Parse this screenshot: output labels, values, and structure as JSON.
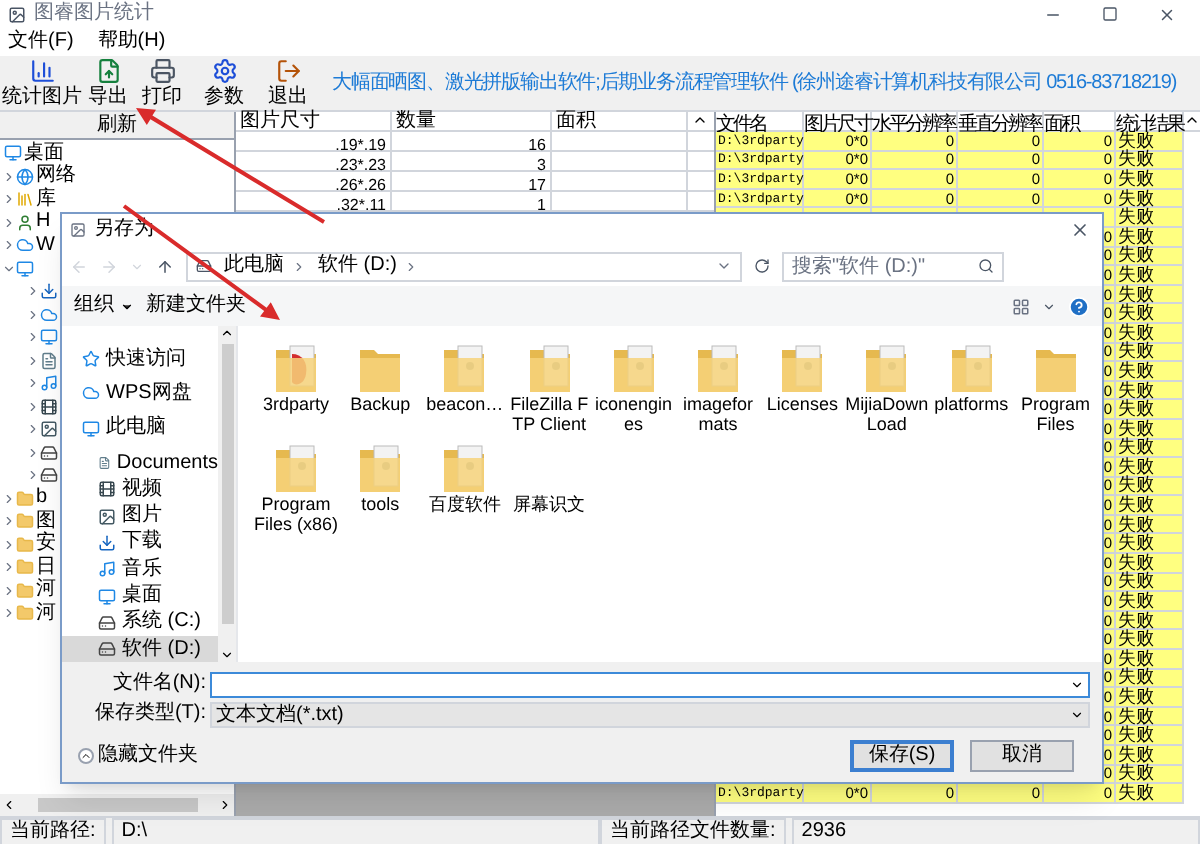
{
  "window": {
    "title": "图睿图片统计"
  },
  "menu": [
    "文件(F)",
    "帮助(H)"
  ],
  "toolbar": [
    {
      "label": "统计图片",
      "kind": "stats"
    },
    {
      "label": "导出",
      "kind": "export"
    },
    {
      "label": "打印",
      "kind": "print"
    },
    {
      "label": "参数",
      "kind": "settings"
    },
    {
      "label": "退出",
      "kind": "exit"
    }
  ],
  "banner": "大幅面晒图、激光拼版输出软件;后期业务流程管理软件 (徐州途睿计算机科技有限公司 0516-83718219)",
  "tree": {
    "header": "刷新",
    "items": [
      {
        "label": "桌面",
        "kind": "desktop",
        "expanded": true,
        "children": [
          {
            "label": "网络",
            "kind": "network",
            "expanded": false
          },
          {
            "label": "库",
            "kind": "library",
            "expanded": false
          },
          {
            "label": "H",
            "kind": "user",
            "expanded": false
          },
          {
            "label": "W",
            "kind": "cloud",
            "expanded": false
          },
          {
            "kind": "pc",
            "expanded": true,
            "children": [
              {
                "kind": "download",
                "expanded": false
              },
              {
                "kind": "cloud",
                "expanded": false
              },
              {
                "kind": "desktop",
                "expanded": false
              },
              {
                "kind": "doc",
                "expanded": false
              },
              {
                "kind": "music",
                "expanded": false
              },
              {
                "kind": "video",
                "expanded": false
              },
              {
                "kind": "image",
                "expanded": false
              },
              {
                "kind": "drive",
                "expanded": false
              },
              {
                "kind": "drive",
                "expanded": false
              }
            ]
          },
          {
            "label": "b",
            "kind": "folder",
            "expanded": false
          },
          {
            "label": "图",
            "kind": "folder",
            "expanded": false
          },
          {
            "label": "安",
            "kind": "folder",
            "expanded": false
          },
          {
            "label": "日",
            "kind": "folder",
            "expanded": false
          },
          {
            "label": "河",
            "kind": "folder",
            "expanded": false
          },
          {
            "label": "河",
            "kind": "folder",
            "expanded": false
          }
        ]
      }
    ]
  },
  "size_table": {
    "columns": [
      "图片尺寸",
      "数量",
      "面积"
    ],
    "rows": [
      {
        "size": ".19*.19",
        "count": "16"
      },
      {
        "size": ".23*.23",
        "count": "3"
      },
      {
        "size": ".26*.26",
        "count": "17"
      },
      {
        "size": ".32*.11",
        "count": "1"
      }
    ]
  },
  "file_table": {
    "columns": [
      "文件名",
      "图片尺寸",
      "水平分辨率",
      "垂直分辨率",
      "面积",
      "统计结果"
    ],
    "rows": [
      {
        "file": "D:\\3rdparty",
        "size": "0*0",
        "h_res": "0",
        "v_res": "0",
        "area": "0",
        "result": "失败"
      },
      {
        "file": "D:\\3rdparty",
        "size": "0*0",
        "h_res": "0",
        "v_res": "0",
        "area": "0",
        "result": "失败"
      },
      {
        "file": "D:\\3rdparty",
        "size": "0*0",
        "h_res": "0",
        "v_res": "0",
        "area": "0",
        "result": "失败"
      },
      {
        "file": "D:\\3rdparty",
        "size": "0*0",
        "h_res": "0",
        "v_res": "0",
        "area": "0",
        "result": "失败"
      },
      {
        "result": "失败"
      },
      {
        "area": "0",
        "result": "失败"
      },
      {
        "area": "0",
        "result": "失败"
      },
      {
        "area": "0",
        "result": "失败"
      },
      {
        "area": "0",
        "result": "失败"
      },
      {
        "area": "0",
        "result": "失败"
      },
      {
        "area": "0",
        "result": "失败"
      },
      {
        "area": "0",
        "result": "失败"
      },
      {
        "area": "0",
        "result": "失败"
      },
      {
        "area": "0",
        "result": "失败"
      },
      {
        "area": "0",
        "result": "失败"
      },
      {
        "area": "0",
        "result": "失败"
      },
      {
        "area": "0",
        "result": "失败"
      },
      {
        "area": "0",
        "result": "失败"
      },
      {
        "area": "0",
        "result": "失败"
      },
      {
        "area": "0",
        "result": "失败"
      },
      {
        "area": "0",
        "result": "失败"
      },
      {
        "area": "0",
        "result": "失败"
      },
      {
        "area": "0",
        "result": "失败"
      },
      {
        "area": "0",
        "result": "失败"
      },
      {
        "area": "0",
        "result": "失败"
      },
      {
        "area": "0",
        "result": "失败"
      },
      {
        "area": "0",
        "result": "失败"
      },
      {
        "area": "0",
        "result": "失败"
      },
      {
        "area": "0",
        "result": "失败"
      },
      {
        "area": "0",
        "result": "失败"
      },
      {
        "area": "0",
        "result": "失败"
      },
      {
        "area": "0",
        "result": "失败"
      },
      {
        "area": "0",
        "result": "失败"
      },
      {
        "area": "0",
        "result": "失败"
      },
      {
        "file": "D:\\3rdparty",
        "size": "0*0",
        "h_res": "0",
        "v_res": "0",
        "area": "0",
        "result": "失败"
      }
    ]
  },
  "status_bar": [
    {
      "label": "当前路径:",
      "value": "D:\\"
    },
    {
      "label": "当前路径文件数量:",
      "value": "2936"
    }
  ],
  "dialog": {
    "title": "另存为",
    "breadcrumb": [
      "此电脑",
      "软件 (D:)"
    ],
    "search_placeholder": "搜索\"软件 (D:)\"",
    "commands": [
      {
        "label": "组织",
        "dropdown": true
      },
      {
        "label": "新建文件夹",
        "dropdown": false
      }
    ],
    "nav": [
      {
        "label": "快速访问",
        "kind": "star",
        "selected": false,
        "group": true
      },
      {
        "label": "WPS网盘",
        "kind": "cloud",
        "selected": false,
        "group": true
      },
      {
        "label": "此电脑",
        "kind": "pc",
        "selected": false,
        "group": true
      },
      {
        "label": "Documents",
        "kind": "doc",
        "selected": false,
        "group": false
      },
      {
        "label": "视频",
        "kind": "video",
        "selected": false,
        "group": false
      },
      {
        "label": "图片",
        "kind": "image",
        "selected": false,
        "group": false
      },
      {
        "label": "下载",
        "kind": "download",
        "selected": false,
        "group": false
      },
      {
        "label": "音乐",
        "kind": "music",
        "selected": false,
        "group": false
      },
      {
        "label": "桌面",
        "kind": "desktop",
        "selected": false,
        "group": false
      },
      {
        "label": "系统 (C:)",
        "kind": "drive",
        "selected": false,
        "group": false
      },
      {
        "label": "软件 (D:)",
        "kind": "drive",
        "selected": true,
        "group": false
      }
    ],
    "folders": [
      {
        "label": "3rdparty",
        "kind": "red"
      },
      {
        "label": "Backup",
        "kind": "plain"
      },
      {
        "label": "beacon…",
        "kind": "paper"
      },
      {
        "label": "FileZilla FTP Client",
        "kind": "paper"
      },
      {
        "label": "iconengines",
        "kind": "paper"
      },
      {
        "label": "imageformats",
        "kind": "paper"
      },
      {
        "label": "Licenses",
        "kind": "paper"
      },
      {
        "label": "MijiaDownLoad",
        "kind": "paper"
      },
      {
        "label": "platforms",
        "kind": "paper"
      },
      {
        "label": "Program Files",
        "kind": "plain"
      },
      {
        "label": "Program Files (x86)",
        "kind": "paper"
      },
      {
        "label": "tools",
        "kind": "paper"
      },
      {
        "label": "百度软件",
        "kind": "paper"
      },
      {
        "label": "屏幕识文",
        "kind": "none"
      }
    ],
    "filename_label": "文件名(N):",
    "filetype_label": "保存类型(T):",
    "filetype": "文本文档(*.txt)",
    "hide_folders": "隐藏文件夹",
    "buttons": [
      {
        "label": "保存(S)",
        "default": true
      },
      {
        "label": "取消",
        "default": false
      }
    ]
  }
}
